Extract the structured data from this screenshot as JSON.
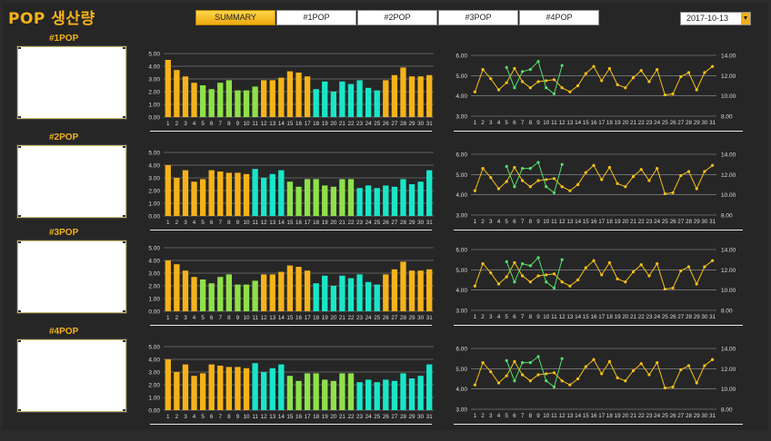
{
  "app": {
    "title": "POP 생산량"
  },
  "tabs": [
    "SUMMARY",
    "#1POP",
    "#2POP",
    "#3POP",
    "#4POP"
  ],
  "active_tab": 0,
  "date": {
    "value": "2017-10-13"
  },
  "colors": {
    "orange": "#f5b21a",
    "green": "#8fe04a",
    "cyan": "#19e6c8",
    "line_orange": "#f5c018",
    "line_green": "#52e06a",
    "grid": "#9a9a9a"
  },
  "icons": {
    "date_dropdown": "chevron-down-icon"
  },
  "sections": [
    {
      "label": "#1POP",
      "chart_data": [
        {
          "type": "bar",
          "categories": [
            "1",
            "2",
            "3",
            "4",
            "5",
            "6",
            "7",
            "8",
            "9",
            "10",
            "11",
            "12",
            "13",
            "14",
            "15",
            "16",
            "17",
            "18",
            "19",
            "20",
            "21",
            "22",
            "23",
            "24",
            "25",
            "26",
            "27",
            "28",
            "29",
            "30",
            "31"
          ],
          "values": [
            4.5,
            3.7,
            3.2,
            2.7,
            2.5,
            2.2,
            2.7,
            2.9,
            2.1,
            2.1,
            2.4,
            2.9,
            2.9,
            3.1,
            3.6,
            3.5,
            3.2,
            2.2,
            2.8,
            2.0,
            2.8,
            2.6,
            2.9,
            2.3,
            2.1,
            2.9,
            3.3,
            3.9,
            3.2,
            3.2,
            3.3
          ],
          "colors": [
            "orange",
            "orange",
            "orange",
            "orange",
            "green",
            "green",
            "green",
            "green",
            "green",
            "green",
            "green",
            "orange",
            "orange",
            "orange",
            "orange",
            "orange",
            "orange",
            "cyan",
            "cyan",
            "cyan",
            "cyan",
            "cyan",
            "cyan",
            "cyan",
            "cyan",
            "orange",
            "orange",
            "orange",
            "orange",
            "orange",
            "orange"
          ],
          "yticks": [
            "5.00",
            "4.00",
            "3.00",
            "2.00",
            "1.00",
            "0.00"
          ],
          "ylim": [
            0,
            5
          ]
        },
        {
          "type": "line",
          "x": [
            "1",
            "2",
            "3",
            "4",
            "5",
            "6",
            "7",
            "8",
            "9",
            "10",
            "11",
            "12",
            "13",
            "14",
            "15",
            "16",
            "17",
            "18",
            "19",
            "20",
            "21",
            "22",
            "23",
            "24",
            "25",
            "26",
            "27",
            "28",
            "29",
            "30",
            "31"
          ],
          "series": [
            {
              "axis": "right",
              "color": "line_orange",
              "values": [
                10.4,
                12.6,
                11.7,
                10.6,
                11.3,
                12.7,
                11.4,
                10.8,
                11.4,
                11.5,
                11.6,
                10.8,
                10.4,
                11.0,
                12.2,
                12.9,
                11.5,
                12.7,
                11.1,
                10.8,
                11.8,
                12.5,
                11.4,
                12.6,
                10.1,
                10.2,
                11.9,
                12.3,
                10.6,
                12.3,
                12.9
              ]
            },
            {
              "axis": "left",
              "color": "line_green",
              "start": 5,
              "values": [
                5.4,
                4.4,
                5.2,
                5.3,
                5.7,
                4.4,
                4.1,
                5.5
              ]
            }
          ],
          "yticks_left": [
            "6.00",
            "5.00",
            "4.00",
            "3.00"
          ],
          "yticks_right": [
            "14.00",
            "12.00",
            "10.00",
            "8.00"
          ],
          "ylim_left": [
            3,
            6
          ],
          "ylim_right": [
            8,
            14
          ]
        }
      ]
    },
    {
      "label": "#2POP",
      "chart_data": [
        {
          "type": "bar",
          "categories": [
            "1",
            "2",
            "3",
            "4",
            "5",
            "6",
            "7",
            "8",
            "9",
            "10",
            "11",
            "12",
            "13",
            "14",
            "15",
            "16",
            "17",
            "18",
            "19",
            "20",
            "21",
            "22",
            "23",
            "24",
            "25",
            "26",
            "27",
            "28",
            "29",
            "30",
            "31"
          ],
          "values": [
            4.0,
            3.0,
            3.6,
            2.7,
            2.9,
            3.6,
            3.5,
            3.4,
            3.4,
            3.3,
            3.7,
            3.0,
            3.3,
            3.6,
            2.7,
            2.3,
            2.9,
            2.9,
            2.4,
            2.3,
            2.9,
            2.9,
            2.2,
            2.4,
            2.2,
            2.4,
            2.3,
            2.9,
            2.5,
            2.7,
            3.6
          ],
          "colors": [
            "orange",
            "orange",
            "orange",
            "orange",
            "orange",
            "orange",
            "orange",
            "orange",
            "orange",
            "orange",
            "cyan",
            "cyan",
            "cyan",
            "cyan",
            "green",
            "green",
            "green",
            "green",
            "green",
            "green",
            "green",
            "green",
            "cyan",
            "cyan",
            "cyan",
            "cyan",
            "cyan",
            "cyan",
            "cyan",
            "cyan",
            "cyan"
          ],
          "yticks": [
            "5.00",
            "4.00",
            "3.00",
            "2.00",
            "1.00",
            "0.00"
          ],
          "ylim": [
            0,
            5
          ]
        },
        {
          "type": "line",
          "x": [
            "1",
            "2",
            "3",
            "4",
            "5",
            "6",
            "7",
            "8",
            "9",
            "10",
            "11",
            "12",
            "13",
            "14",
            "15",
            "16",
            "17",
            "18",
            "19",
            "20",
            "21",
            "22",
            "23",
            "24",
            "25",
            "26",
            "27",
            "28",
            "29",
            "30",
            "31"
          ],
          "series": [
            {
              "axis": "right",
              "color": "line_orange",
              "values": [
                10.4,
                12.6,
                11.7,
                10.6,
                11.3,
                12.7,
                11.4,
                10.8,
                11.4,
                11.5,
                11.6,
                10.8,
                10.4,
                11.0,
                12.2,
                12.9,
                11.5,
                12.7,
                11.1,
                10.8,
                11.8,
                12.5,
                11.4,
                12.6,
                10.1,
                10.2,
                11.9,
                12.3,
                10.6,
                12.3,
                12.9
              ]
            },
            {
              "axis": "left",
              "color": "line_green",
              "start": 5,
              "values": [
                5.4,
                4.4,
                5.3,
                5.3,
                5.6,
                4.4,
                4.1,
                5.5
              ]
            }
          ],
          "yticks_left": [
            "6.00",
            "5.00",
            "4.00",
            "3.00"
          ],
          "yticks_right": [
            "14.00",
            "12.00",
            "10.00",
            "8.00"
          ],
          "ylim_left": [
            3,
            6
          ],
          "ylim_right": [
            8,
            14
          ]
        }
      ]
    },
    {
      "label": "#3POP",
      "chart_data": [
        {
          "type": "bar",
          "categories": [
            "1",
            "2",
            "3",
            "4",
            "5",
            "6",
            "7",
            "8",
            "9",
            "10",
            "11",
            "12",
            "13",
            "14",
            "15",
            "16",
            "17",
            "18",
            "19",
            "20",
            "21",
            "22",
            "23",
            "24",
            "25",
            "26",
            "27",
            "28",
            "29",
            "30",
            "31"
          ],
          "values": [
            4.0,
            3.7,
            3.2,
            2.7,
            2.5,
            2.2,
            2.7,
            2.9,
            2.1,
            2.1,
            2.4,
            2.9,
            2.9,
            3.1,
            3.6,
            3.5,
            3.2,
            2.2,
            2.8,
            2.0,
            2.8,
            2.6,
            2.9,
            2.3,
            2.1,
            2.9,
            3.3,
            3.9,
            3.2,
            3.2,
            3.3
          ],
          "colors": [
            "orange",
            "orange",
            "orange",
            "orange",
            "green",
            "green",
            "green",
            "green",
            "green",
            "green",
            "green",
            "orange",
            "orange",
            "orange",
            "orange",
            "orange",
            "orange",
            "cyan",
            "cyan",
            "cyan",
            "cyan",
            "cyan",
            "cyan",
            "cyan",
            "cyan",
            "orange",
            "orange",
            "orange",
            "orange",
            "orange",
            "orange"
          ],
          "yticks": [
            "5.00",
            "4.00",
            "3.00",
            "2.00",
            "1.00",
            "0.00"
          ],
          "ylim": [
            0,
            5
          ]
        },
        {
          "type": "line",
          "x": [
            "1",
            "2",
            "3",
            "4",
            "5",
            "6",
            "7",
            "8",
            "9",
            "10",
            "11",
            "12",
            "13",
            "14",
            "15",
            "16",
            "17",
            "18",
            "19",
            "20",
            "21",
            "22",
            "23",
            "24",
            "25",
            "26",
            "27",
            "28",
            "29",
            "30",
            "31"
          ],
          "series": [
            {
              "axis": "right",
              "color": "line_orange",
              "values": [
                10.4,
                12.6,
                11.7,
                10.6,
                11.3,
                12.7,
                11.4,
                10.8,
                11.4,
                11.5,
                11.6,
                10.8,
                10.4,
                11.0,
                12.2,
                12.9,
                11.5,
                12.7,
                11.1,
                10.8,
                11.8,
                12.5,
                11.4,
                12.6,
                10.1,
                10.2,
                11.9,
                12.3,
                10.6,
                12.3,
                12.9
              ]
            },
            {
              "axis": "left",
              "color": "line_green",
              "start": 5,
              "values": [
                5.4,
                4.4,
                5.3,
                5.2,
                5.6,
                4.4,
                4.1,
                5.5
              ]
            }
          ],
          "yticks_left": [
            "6.00",
            "5.00",
            "4.00",
            "3.00"
          ],
          "yticks_right": [
            "14.00",
            "12.00",
            "10.00",
            "8.00"
          ],
          "ylim_left": [
            3,
            6
          ],
          "ylim_right": [
            8,
            14
          ]
        }
      ]
    },
    {
      "label": "#4POP",
      "chart_data": [
        {
          "type": "bar",
          "categories": [
            "1",
            "2",
            "3",
            "4",
            "5",
            "6",
            "7",
            "8",
            "9",
            "10",
            "11",
            "12",
            "13",
            "14",
            "15",
            "16",
            "17",
            "18",
            "19",
            "20",
            "21",
            "22",
            "23",
            "24",
            "25",
            "26",
            "27",
            "28",
            "29",
            "30",
            "31"
          ],
          "values": [
            4.0,
            3.0,
            3.6,
            2.7,
            2.9,
            3.6,
            3.5,
            3.4,
            3.4,
            3.3,
            3.7,
            3.0,
            3.3,
            3.6,
            2.7,
            2.3,
            2.9,
            2.9,
            2.4,
            2.3,
            2.9,
            2.9,
            2.2,
            2.4,
            2.2,
            2.4,
            2.3,
            2.9,
            2.5,
            2.7,
            3.6
          ],
          "colors": [
            "orange",
            "orange",
            "orange",
            "orange",
            "orange",
            "orange",
            "orange",
            "orange",
            "orange",
            "orange",
            "cyan",
            "cyan",
            "cyan",
            "cyan",
            "green",
            "green",
            "green",
            "green",
            "green",
            "green",
            "green",
            "green",
            "cyan",
            "cyan",
            "cyan",
            "cyan",
            "cyan",
            "cyan",
            "cyan",
            "cyan",
            "cyan"
          ],
          "yticks": [
            "5.00",
            "4.00",
            "3.00",
            "2.00",
            "1.00",
            "0.00"
          ],
          "ylim": [
            0,
            5
          ]
        },
        {
          "type": "line",
          "x": [
            "1",
            "2",
            "3",
            "4",
            "5",
            "6",
            "7",
            "8",
            "9",
            "10",
            "11",
            "12",
            "13",
            "14",
            "15",
            "16",
            "17",
            "18",
            "19",
            "20",
            "21",
            "22",
            "23",
            "24",
            "25",
            "26",
            "27",
            "28",
            "29",
            "30",
            "31"
          ],
          "series": [
            {
              "axis": "right",
              "color": "line_orange",
              "values": [
                10.4,
                12.6,
                11.7,
                10.6,
                11.3,
                12.7,
                11.4,
                10.8,
                11.4,
                11.5,
                11.6,
                10.8,
                10.4,
                11.0,
                12.2,
                12.9,
                11.5,
                12.7,
                11.1,
                10.8,
                11.8,
                12.5,
                11.4,
                12.6,
                10.1,
                10.2,
                11.9,
                12.3,
                10.6,
                12.3,
                12.9
              ]
            },
            {
              "axis": "left",
              "color": "line_green",
              "start": 5,
              "values": [
                5.4,
                4.4,
                5.3,
                5.3,
                5.6,
                4.4,
                4.1,
                5.5
              ]
            }
          ],
          "yticks_left": [
            "6.00",
            "5.00",
            "4.00",
            "3.00"
          ],
          "yticks_right": [
            "14.00",
            "12.00",
            "10.00",
            "8.00"
          ],
          "ylim_left": [
            3,
            6
          ],
          "ylim_right": [
            8,
            14
          ]
        }
      ]
    }
  ]
}
